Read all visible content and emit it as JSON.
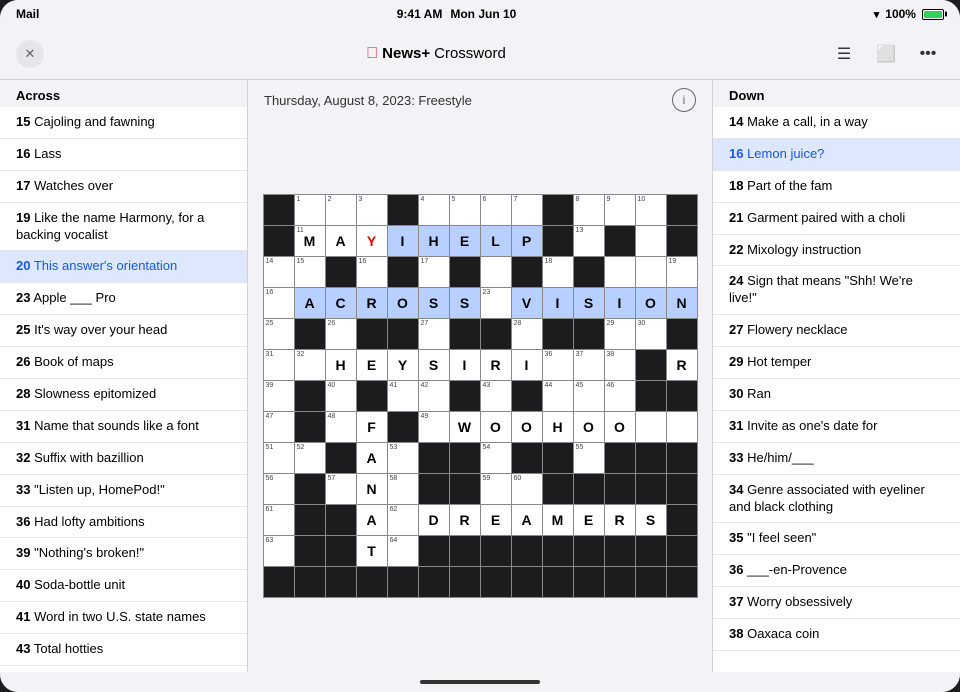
{
  "statusBar": {
    "left": "Mail",
    "time": "9:41 AM",
    "date": "Mon Jun 10",
    "wifi": "WiFi",
    "battery": "100%"
  },
  "navBar": {
    "closeBtn": "✕",
    "appleLogo": "",
    "title": "News+ Crossword",
    "icons": [
      "list",
      "tv",
      "ellipsis"
    ]
  },
  "crosswordHeader": {
    "title": "Thursday, August 8, 2023: Freestyle",
    "infoBtn": "i"
  },
  "acrossHeader": "Across",
  "downHeader": "Down",
  "acrossClues": [
    {
      "num": "15",
      "text": "Cajoling and fawning"
    },
    {
      "num": "16",
      "text": "Lass"
    },
    {
      "num": "17",
      "text": "Watches over"
    },
    {
      "num": "19",
      "text": "Like the name Harmony, for a backing vocalist"
    },
    {
      "num": "20",
      "text": "This answer's orientation",
      "active": true
    },
    {
      "num": "23",
      "text": "Apple ___ Pro"
    },
    {
      "num": "25",
      "text": "It's way over your head"
    },
    {
      "num": "26",
      "text": "Book of maps"
    },
    {
      "num": "28",
      "text": "Slowness epitomized"
    },
    {
      "num": "31",
      "text": "Name that sounds like a font"
    },
    {
      "num": "32",
      "text": "Suffix with bazillion"
    },
    {
      "num": "33",
      "text": "\"Listen up, HomePod!\""
    },
    {
      "num": "36",
      "text": "Had lofty ambitions"
    },
    {
      "num": "39",
      "text": "\"Nothing's broken!\""
    },
    {
      "num": "40",
      "text": "Soda-bottle unit"
    },
    {
      "num": "41",
      "text": "Word in two U.S. state names"
    },
    {
      "num": "43",
      "text": "Total hotties"
    }
  ],
  "downClues": [
    {
      "num": "14",
      "text": "Make a call, in a way"
    },
    {
      "num": "16",
      "text": "Lemon juice?",
      "active": true
    },
    {
      "num": "18",
      "text": "Part of the fam"
    },
    {
      "num": "21",
      "text": "Garment paired with a choli"
    },
    {
      "num": "22",
      "text": "Mixology instruction"
    },
    {
      "num": "24",
      "text": "Sign that means \"Shh! We're live!\""
    },
    {
      "num": "27",
      "text": "Flowery necklace"
    },
    {
      "num": "29",
      "text": "Hot temper"
    },
    {
      "num": "30",
      "text": "Ran"
    },
    {
      "num": "31",
      "text": "Invite as one's date for"
    },
    {
      "num": "33",
      "text": "He/him/___"
    },
    {
      "num": "34",
      "text": "Genre associated with eyeliner and black clothing"
    },
    {
      "num": "35",
      "text": "\"I feel seen\""
    },
    {
      "num": "36",
      "text": "___-en-Provence"
    },
    {
      "num": "37",
      "text": "Worry obsessively"
    },
    {
      "num": "38",
      "text": "Oaxaca coin"
    }
  ]
}
